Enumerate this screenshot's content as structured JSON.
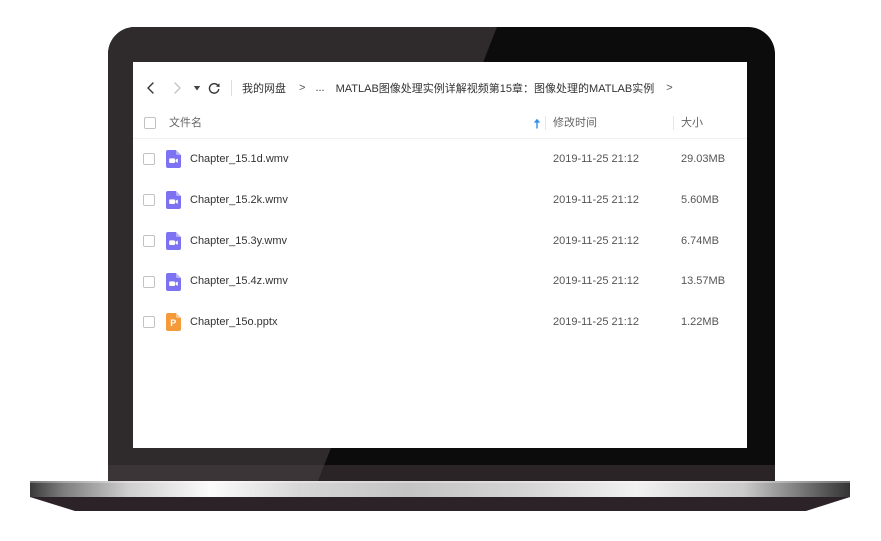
{
  "nav": {
    "back_icon": "chevron-left-icon",
    "forward_icon": "chevron-right-icon",
    "history_icon": "caret-down-icon",
    "refresh_icon": "refresh-icon"
  },
  "breadcrumb": {
    "root": "我的网盘",
    "separator": ">",
    "ellipsis": "...",
    "current": "MATLAB图像处理实例详解视频第15章：图像处理的MATLAB实例"
  },
  "columns": {
    "name": "文件名",
    "modified": "修改时间",
    "size": "大小",
    "sort_icon": "arrow-up-icon"
  },
  "files": [
    {
      "name": "Chapter_15.1d.wmv",
      "modified": "2019-11-25 21:12",
      "size": "29.03MB",
      "icon": "video-file-icon"
    },
    {
      "name": "Chapter_15.2k.wmv",
      "modified": "2019-11-25 21:12",
      "size": "5.60MB",
      "icon": "video-file-icon"
    },
    {
      "name": "Chapter_15.3y.wmv",
      "modified": "2019-11-25 21:12",
      "size": "6.74MB",
      "icon": "video-file-icon"
    },
    {
      "name": "Chapter_15.4z.wmv",
      "modified": "2019-11-25 21:12",
      "size": "13.57MB",
      "icon": "video-file-icon"
    },
    {
      "name": "Chapter_15o.pptx",
      "modified": "2019-11-25 21:12",
      "size": "1.22MB",
      "icon": "pptx-file-icon",
      "icon_letter": "P"
    }
  ],
  "colors": {
    "accent": "#2e8ef0",
    "video_icon": "#7c72f2",
    "pptx_icon": "#f59a3b"
  }
}
